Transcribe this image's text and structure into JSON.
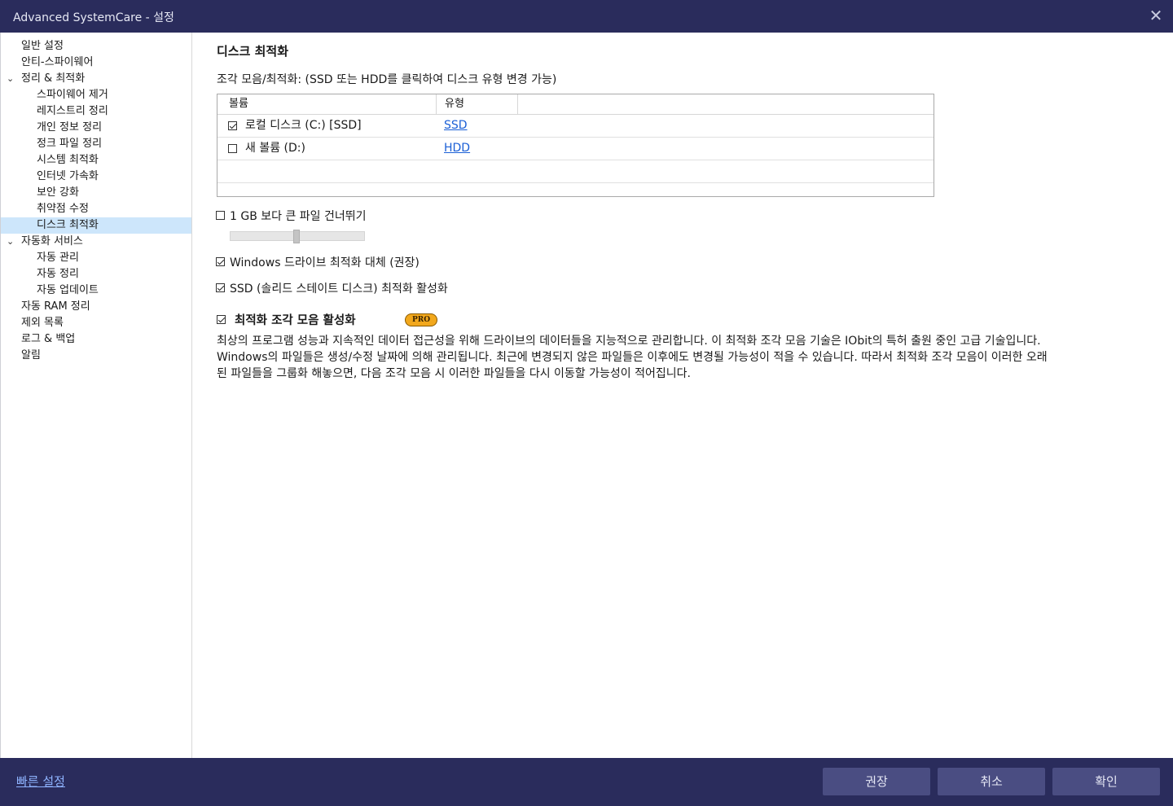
{
  "window": {
    "title": "Advanced SystemCare - 설정",
    "close_glyph": "✕"
  },
  "sidebar": {
    "items": [
      {
        "label": "일반 설정"
      },
      {
        "label": "안티-스파이웨어"
      },
      {
        "label": "정리 & 최적화",
        "expanded": true
      },
      {
        "label": "스파이웨어 제거"
      },
      {
        "label": "레지스트리 정리"
      },
      {
        "label": "개인 정보 정리"
      },
      {
        "label": "정크 파일 정리"
      },
      {
        "label": "시스템 최적화"
      },
      {
        "label": "인터넷 가속화"
      },
      {
        "label": "보안 강화"
      },
      {
        "label": "취약점 수정"
      },
      {
        "label": "디스크 최적화",
        "selected": true
      },
      {
        "label": "자동화 서비스",
        "expanded": true
      },
      {
        "label": "자동 관리"
      },
      {
        "label": "자동 정리"
      },
      {
        "label": "자동 업데이트"
      },
      {
        "label": "자동 RAM 정리"
      },
      {
        "label": "제외 목록"
      },
      {
        "label": "로그 & 백업"
      },
      {
        "label": "알림"
      }
    ]
  },
  "main": {
    "section_title": "디스크 최적화",
    "subtitle": "조각 모음/최적화: (SSD 또는 HDD를 클릭하여 디스크 유형 변경 가능)",
    "table": {
      "columns": [
        "볼륨",
        "유형"
      ],
      "rows": [
        {
          "name": "로컬 디스크 (C:) [SSD]",
          "type": "SSD",
          "checked": true
        },
        {
          "name": "새 볼륨 (D:)",
          "type": "HDD",
          "checked": false
        }
      ]
    },
    "options": {
      "skip_large": {
        "label": "1 GB 보다 큰 파일 건너뛰기",
        "checked": false
      },
      "slider_value_fraction": 0.5,
      "replace_windows": {
        "label": "Windows 드라이브 최적화 대체 (권장)",
        "checked": true
      },
      "ssd_enable": {
        "label": "SSD (솔리드 스테이트 디스크) 최적화 활성화",
        "checked": true
      },
      "defrag_enable": {
        "label": "최적화 조각 모음 활성화",
        "checked": true,
        "badge": "PRO"
      }
    },
    "description_lines": [
      "최상의 프로그램 성능과 지속적인 데이터 접근성을 위해 드라이브의 데이터들을 지능적으로 관리합니다. 이 최적화 조각 모음 기술은 IObit의 특허 출원 중인 고급 기술입니다.",
      "Windows의 파일들은 생성/수정 날짜에 의해 관리됩니다. 최근에 변경되지 않은 파일들은 이후에도 변경될 가능성이 적을 수 있습니다. 따라서 최적화 조각 모음이 이러한 오래",
      "된 파일들을 그룹화 해놓으면, 다음 조각 모음 시 이러한 파일들을 다시 이동할 가능성이 적어집니다."
    ]
  },
  "footer": {
    "quick_settings": "빠른 설정",
    "buttons": {
      "recommend": "권장",
      "cancel": "취소",
      "ok": "확인"
    }
  },
  "colors": {
    "titlebar": "#2a2c5c",
    "button": "#4a4d82",
    "selected_nav": "#cde6fb",
    "link": "#1a5fd6",
    "pro_badge": "#f2a81d"
  }
}
